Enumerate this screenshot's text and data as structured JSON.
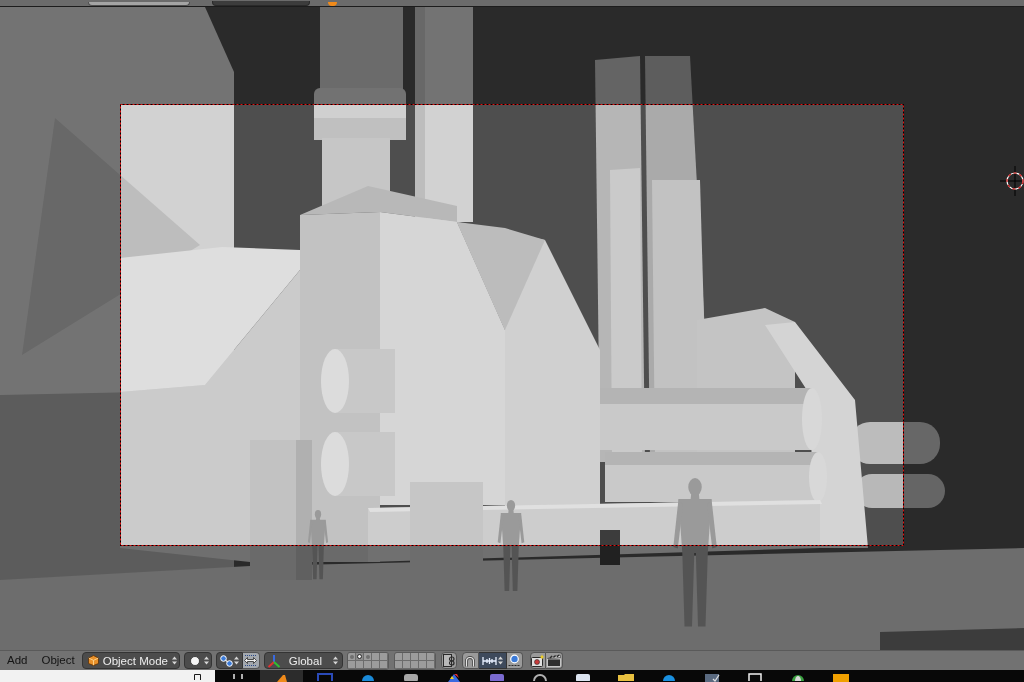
{
  "header": {
    "menus": [
      {
        "label": "Add"
      },
      {
        "label": "Object"
      }
    ],
    "mode": {
      "label": "Object Mode"
    },
    "orientation": {
      "label": "Global"
    },
    "layers": [
      {
        "selected": false,
        "used": true
      },
      {
        "selected": true,
        "used": true
      },
      {
        "selected": false,
        "used": true
      },
      {
        "selected": false,
        "used": false
      },
      {
        "selected": false,
        "used": false
      },
      {
        "selected": false,
        "used": false
      },
      {
        "selected": false,
        "used": false
      },
      {
        "selected": false,
        "used": false
      },
      {
        "selected": false,
        "used": false
      },
      {
        "selected": false,
        "used": false
      },
      {
        "selected": false,
        "used": false
      },
      {
        "selected": false,
        "used": false
      },
      {
        "selected": false,
        "used": false
      },
      {
        "selected": false,
        "used": false
      },
      {
        "selected": false,
        "used": false
      },
      {
        "selected": false,
        "used": false
      },
      {
        "selected": false,
        "used": false
      },
      {
        "selected": false,
        "used": false
      },
      {
        "selected": false,
        "used": false
      },
      {
        "selected": false,
        "used": false
      }
    ]
  },
  "taskbar": {
    "items": [
      {
        "selected": false
      },
      {
        "selected": true
      },
      {
        "selected": false
      },
      {
        "selected": false
      },
      {
        "selected": false
      },
      {
        "selected": false
      },
      {
        "selected": false
      },
      {
        "selected": false
      },
      {
        "selected": false
      },
      {
        "selected": false
      },
      {
        "selected": false
      },
      {
        "selected": false
      },
      {
        "selected": false
      },
      {
        "selected": false
      },
      {
        "selected": false
      }
    ]
  }
}
